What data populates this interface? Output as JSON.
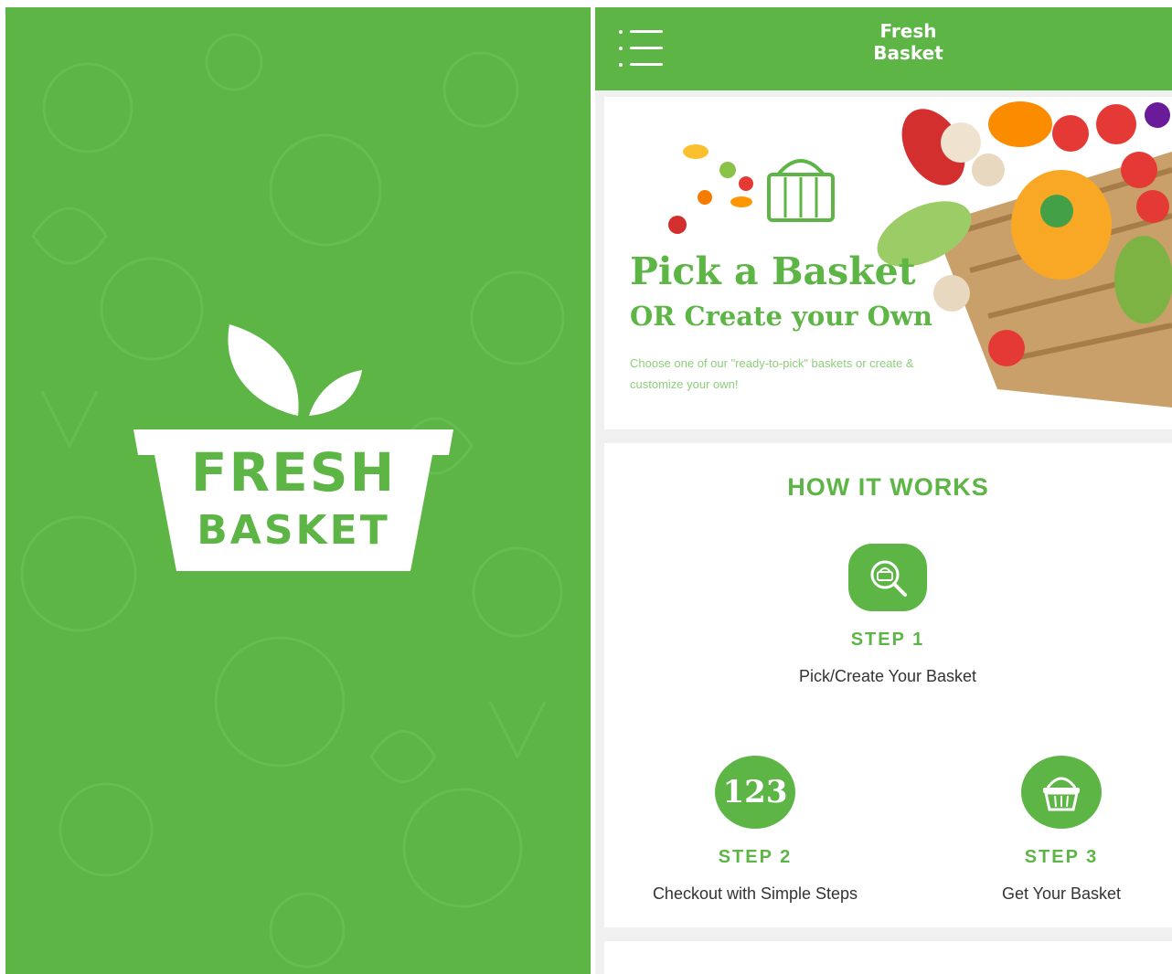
{
  "splash": {
    "logo_line1": "FRESH",
    "logo_line2": "BASKET",
    "background_color": "#5cb545"
  },
  "app": {
    "topbar": {
      "title": "Fresh\nBasket",
      "menu_icon": "hamburger-menu-icon",
      "color": "#5cb545"
    },
    "hero": {
      "title": "Pick a Basket",
      "subtitle": "OR Create your Own",
      "description": "Choose one of our \"ready-to-pick\" baskets or create & customize your own!"
    },
    "how_it_works": {
      "title": "HOW IT WORKS",
      "steps": [
        {
          "label": "STEP 1",
          "description": "Pick/Create Your Basket",
          "icon": "basket-search-icon"
        },
        {
          "label": "STEP 2",
          "description": "Checkout with Simple Steps",
          "icon": "numbers-123-icon",
          "icon_text": "123"
        },
        {
          "label": "STEP 3",
          "description": "Get Your Basket",
          "icon": "basket-icon"
        }
      ]
    }
  }
}
